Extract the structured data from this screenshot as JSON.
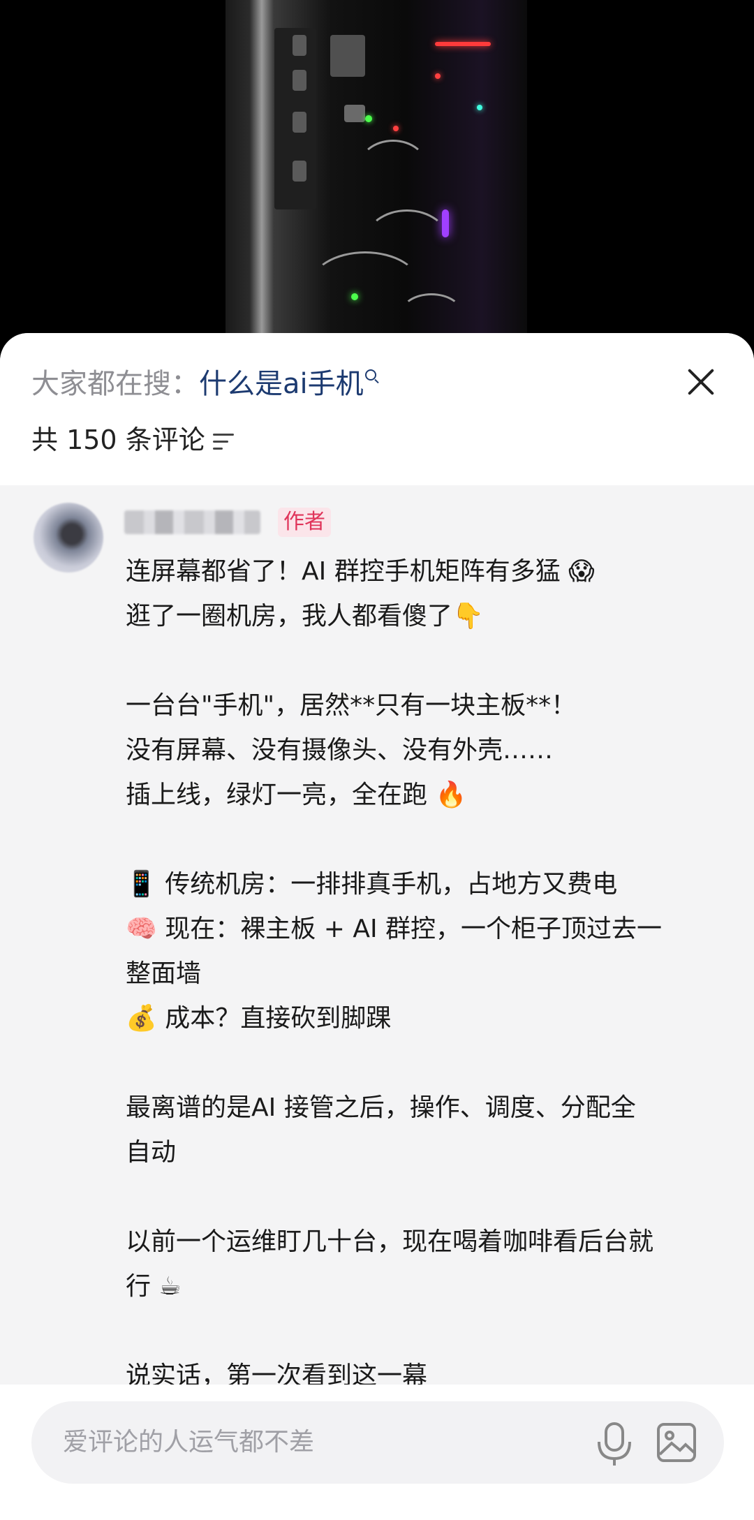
{
  "search_bar": {
    "prefix": "大家都在搜：",
    "query": "什么是ai手机"
  },
  "comments_header": {
    "count_text": "共 150 条评论"
  },
  "comment": {
    "badge": "作者",
    "lines": [
      "连屏幕都省了！AI 群控手机矩阵有多猛 😱",
      "逛了一圈机房，我人都看傻了👇",
      "",
      "一台台\"手机\"，居然**只有一块主板**！",
      "没有屏幕、没有摄像头、没有外壳……",
      "插上线，绿灯一亮，全在跑 🔥",
      "",
      "📱 传统机房：一排排真手机，占地方又费电",
      "🧠 现在：裸主板 + AI 群控，一个柜子顶过去一",
      "整面墙",
      "💰 成本？直接砍到脚踝",
      "",
      "最离谱的是AI 接管之后，操作、调度、分配全",
      "自动",
      "",
      "以前一个运维盯几十台，现在喝着咖啡看后台就",
      "行 ☕",
      "",
      "说实话，第一次看到这一幕"
    ]
  },
  "input": {
    "placeholder": "爱评论的人运气都不差"
  }
}
